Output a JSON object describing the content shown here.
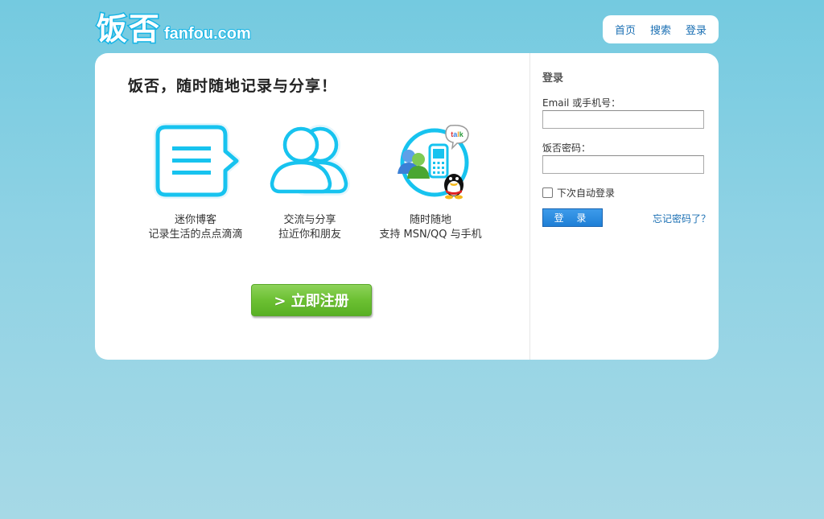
{
  "brand": {
    "logo_cn": "饭否",
    "logo_en": "fanfou.com"
  },
  "topnav": {
    "items": [
      "首页",
      "搜索",
      "登录"
    ]
  },
  "main": {
    "slogan": "饭否，随时随地记录与分享！",
    "features": [
      {
        "icon": "speech-bubble-icon",
        "line1": "迷你博客",
        "line2": "记录生活的点点滴滴"
      },
      {
        "icon": "friends-icon",
        "line1": "交流与分享",
        "line2": "拉近你和朋友"
      },
      {
        "icon": "mobile-im-icon",
        "line1": "随时随地",
        "line2": "支持 MSN/QQ 与手机"
      }
    ],
    "register_label": "> 立即注册"
  },
  "login": {
    "title": "登录",
    "email_label": "Email 或手机号：",
    "email_value": "",
    "password_label": "饭否密码：",
    "password_value": "",
    "remember_label": "下次自动登录",
    "remember_checked": false,
    "submit_label": "登 录",
    "forgot_label": "忘记密码了？"
  },
  "colors": {
    "accent": "#1ac6ee",
    "link": "#1a6fb3",
    "register_green": "#6cc032",
    "login_blue": "#2486dc"
  }
}
